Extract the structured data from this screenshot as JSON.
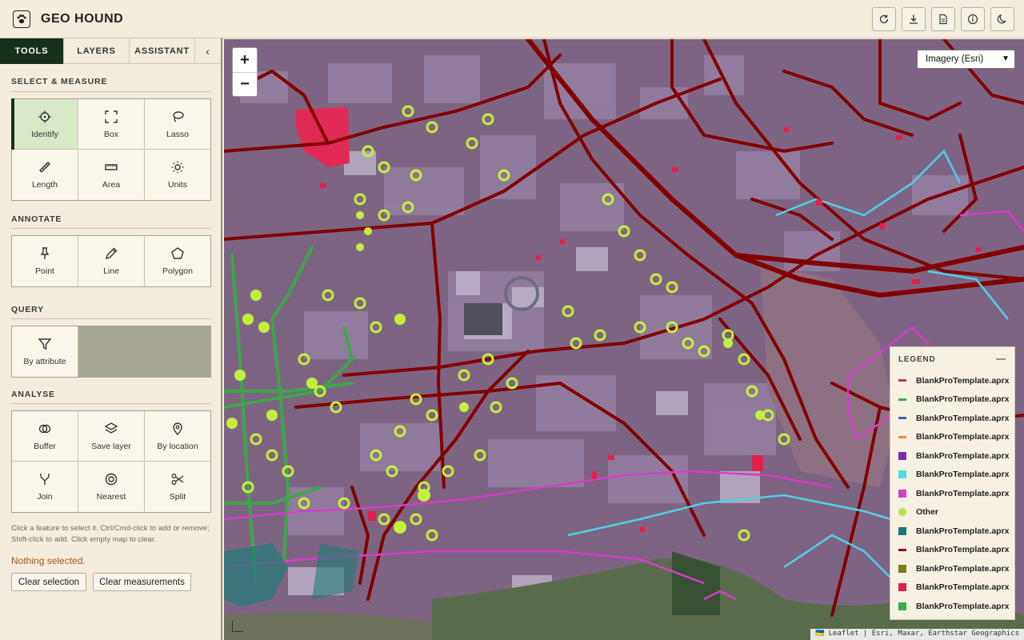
{
  "header": {
    "title": "GEO HOUND",
    "logo_icon": "paw-icon",
    "buttons": [
      {
        "name": "refresh-button",
        "icon": "refresh-icon"
      },
      {
        "name": "download-button",
        "icon": "download-icon"
      },
      {
        "name": "document-button",
        "icon": "document-icon"
      },
      {
        "name": "info-button",
        "icon": "info-icon"
      },
      {
        "name": "dark-mode-button",
        "icon": "moon-icon"
      }
    ]
  },
  "sidebar": {
    "tabs": [
      {
        "label": "TOOLS",
        "active": true
      },
      {
        "label": "LAYERS",
        "active": false
      },
      {
        "label": "ASSISTANT",
        "active": false
      }
    ],
    "collapse_label": "‹",
    "sections": {
      "select": {
        "title": "SELECT & MEASURE",
        "tools": [
          "Identify",
          "Box",
          "Lasso",
          "Length",
          "Area",
          "Units"
        ]
      },
      "annotate": {
        "title": "ANNOTATE",
        "tools": [
          "Point",
          "Line",
          "Polygon"
        ]
      },
      "query": {
        "title": "QUERY",
        "tools": [
          "By attribute"
        ]
      },
      "analyse": {
        "title": "ANALYSE",
        "tools": [
          "Buffer",
          "Save layer",
          "By location",
          "Join",
          "Nearest",
          "Split"
        ]
      }
    },
    "help_text": "Click a feature to select it. Ctrl/Cmd-click to add or remove; Shift-click to add. Click empty map to clear.",
    "status_text": "Nothing selected.",
    "clear_selection_label": "Clear selection",
    "clear_measurements_label": "Clear measurements"
  },
  "map": {
    "zoom_in_label": "+",
    "zoom_out_label": "−",
    "basemap_selected": "Imagery (Esri)",
    "attribution": "🇺🇦 Leaflet | Esri, Maxar, Earthstar Geographics",
    "legend": {
      "title": "LEGEND",
      "minimize_label": "—",
      "items": [
        {
          "label": "BlankProTemplate.aprx",
          "color": "#d22b4f",
          "kind": "line"
        },
        {
          "label": "BlankProTemplate.aprx",
          "color": "#3cb043",
          "kind": "line"
        },
        {
          "label": "BlankProTemplate.aprx",
          "color": "#3f5fbf",
          "kind": "line"
        },
        {
          "label": "BlankProTemplate.aprx",
          "color": "#e88a3c",
          "kind": "line"
        },
        {
          "label": "BlankProTemplate.aprx",
          "color": "#7b2fa8",
          "kind": "box"
        },
        {
          "label": "BlankProTemplate.aprx",
          "color": "#4fdde8",
          "kind": "box"
        },
        {
          "label": "BlankProTemplate.aprx",
          "color": "#d43fc8",
          "kind": "box"
        },
        {
          "label": "Other",
          "color": "#b7e34a",
          "kind": "dot"
        },
        {
          "label": "BlankProTemplate.aprx",
          "color": "#1c7a78",
          "kind": "box"
        },
        {
          "label": "BlankProTemplate.aprx",
          "color": "#8b0000",
          "kind": "line"
        },
        {
          "label": "BlankProTemplate.aprx",
          "color": "#7d7a1a",
          "kind": "box"
        },
        {
          "label": "BlankProTemplate.aprx",
          "color": "#e0204b",
          "kind": "box"
        },
        {
          "label": "BlankProTemplate.aprx",
          "color": "#35b04a",
          "kind": "box"
        }
      ]
    }
  }
}
